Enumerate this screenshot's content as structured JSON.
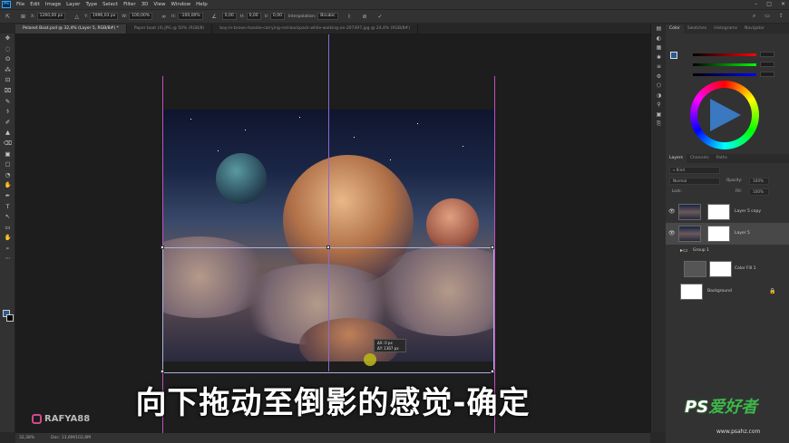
{
  "menu": {
    "app_icon": "Ps",
    "items": [
      "File",
      "Edit",
      "Image",
      "Layer",
      "Type",
      "Select",
      "Filter",
      "3D",
      "View",
      "Window",
      "Help"
    ],
    "window_controls": [
      "–",
      "□",
      "✕"
    ]
  },
  "options": {
    "x_label": "X:",
    "x_value": "1260,00 px",
    "y_label": "Y:",
    "y_value": "1996,03 px",
    "w_label": "W:",
    "w_value": "100,00%",
    "h_label": "H:",
    "h_value": "-100,00%",
    "angle_value": "0,00",
    "hskew_label": "H:",
    "hskew_value": "0,00",
    "vskew_label": "V:",
    "vskew_value": "0,00",
    "interp_label": "Interpolation:",
    "interp_value": "Bicubic",
    "cancel_icon": "⊘",
    "commit_icon": "✓",
    "right_icons": [
      "⌕",
      "▭",
      "⇪"
    ]
  },
  "tabs": [
    {
      "label": "Pelanet Boat.psd @ 32,4% (Layer 5, RGB/8#) *",
      "active": true
    },
    {
      "label": "Paper boat (4).JPG @ 50% (RGB/8)",
      "active": false
    },
    {
      "label": "boy-in-brown-hoodie-carrying-red-backpack-while-walking-on-207497.jpg @ 24,4% (RGB/8#)",
      "active": false
    }
  ],
  "tools": [
    "✥",
    "◌",
    "ʘ",
    "⁂",
    "⊡",
    "⌧",
    "✎",
    "⚕",
    "✐",
    "▲",
    "⌫",
    "▣",
    "▢",
    "◔",
    "✋",
    "✒",
    "T",
    "↖",
    "▭",
    "✋",
    "⌕",
    "⋯"
  ],
  "tooltip": {
    "line1": "ΔX:      0 px",
    "line2": "ΔY:  1367 px"
  },
  "subtitle": "向下拖动至倒影的感觉-确定",
  "watermark_left": "RAFYA88",
  "status": {
    "zoom": "32,38%",
    "doc": "Doc: 13,6M/102,8M"
  },
  "midstrip_icons": [
    "▤",
    "◐",
    "▦",
    "✱",
    "≡",
    "⚙",
    "⬡",
    "◑",
    "⚲",
    "▣",
    "⎘"
  ],
  "color_panel": {
    "tabs": [
      "Color",
      "Swatches",
      "Histograms",
      "Navigator"
    ],
    "fg_color": "#2a5b92",
    "values": [
      "153",
      "102",
      "77"
    ]
  },
  "layers_panel": {
    "tabs": [
      "Layers",
      "Channels",
      "Paths"
    ],
    "kind_label": "⌕ Kind",
    "blend_mode": "Normal",
    "opacity_label": "Opacity:",
    "opacity_value": "100%",
    "lock_label": "Lock:",
    "fill_label": "Fill:",
    "fill_value": "100%",
    "layers": [
      {
        "name": "Layer 5 copy",
        "visible": true,
        "selected": false
      },
      {
        "name": "Layer 5",
        "visible": true,
        "selected": true
      },
      {
        "name": "Group 1",
        "visible": false,
        "selected": false
      },
      {
        "name": "Color Fill 1",
        "visible": false,
        "selected": false
      },
      {
        "name": "Background",
        "visible": false,
        "selected": false
      }
    ]
  },
  "logo_right": {
    "ps": "PS",
    "text": "爱好者",
    "url": "www.psahz.com"
  }
}
